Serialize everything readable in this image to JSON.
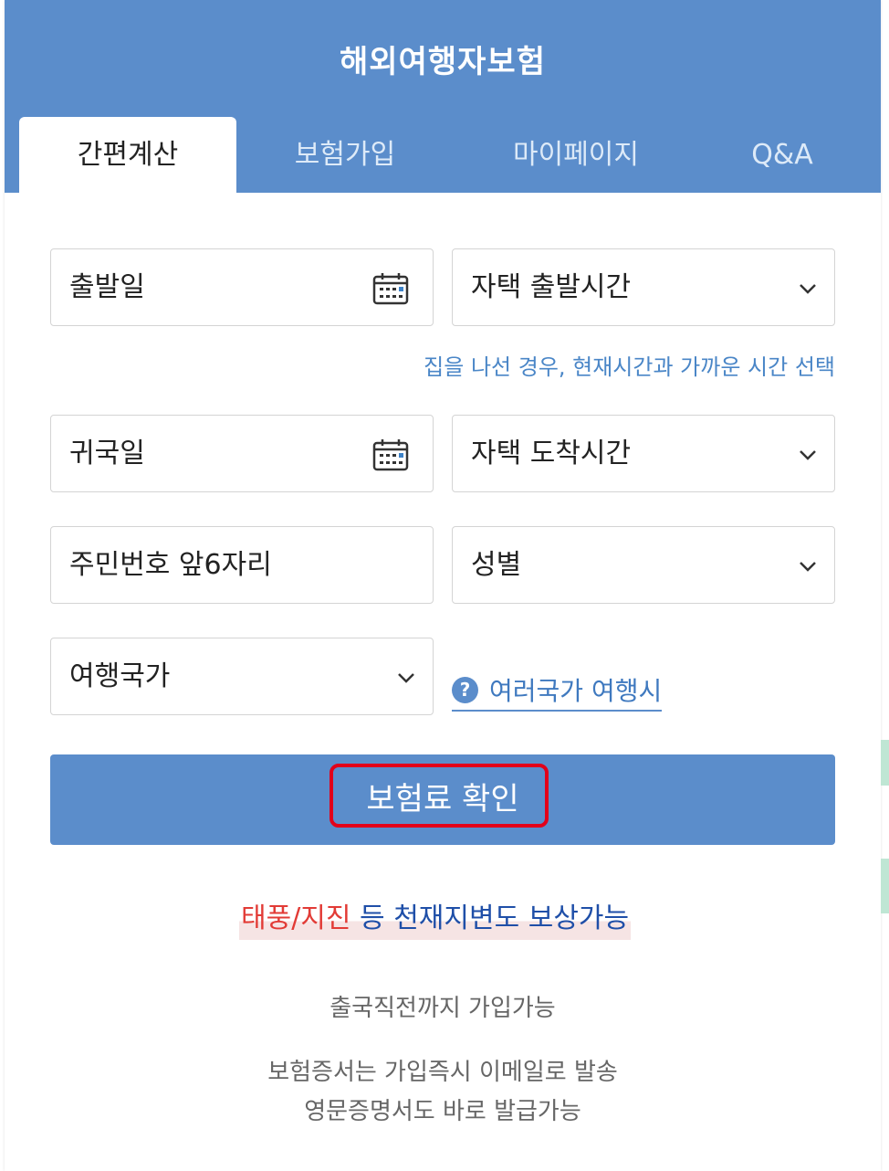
{
  "header": {
    "title": "해외여행자보험",
    "tabs": [
      {
        "label": "간편계산",
        "active": true
      },
      {
        "label": "보험가입",
        "active": false
      },
      {
        "label": "마이페이지",
        "active": false
      },
      {
        "label": "Q&A",
        "active": false
      }
    ]
  },
  "form": {
    "departure_date": {
      "label": "출발일",
      "icon": "calendar-icon"
    },
    "departure_time": {
      "label": "자택 출발시간",
      "icon": "chevron-down-icon"
    },
    "departure_hint": "집을 나선 경우, 현재시간과 가까운 시간 선택",
    "return_date": {
      "label": "귀국일",
      "icon": "calendar-icon"
    },
    "arrival_time": {
      "label": "자택 도착시간",
      "icon": "chevron-down-icon"
    },
    "id_number": {
      "label": "주민번호 앞6자리"
    },
    "gender": {
      "label": "성별",
      "icon": "chevron-down-icon"
    },
    "country": {
      "label": "여행국가",
      "icon": "chevron-down-icon"
    },
    "multi_country_link": {
      "icon_text": "?",
      "label": "여러국가 여행시"
    },
    "submit_label": "보험료 확인"
  },
  "promo": {
    "red_text": "태풍/지진",
    "blue_text": " 등 천재지변도 보상가능"
  },
  "info": {
    "line1": "출국직전까지 가입가능",
    "line2": "보험증서는 가입즉시 이메일로 발송",
    "line3": "영문증명서도 바로 발급가능"
  },
  "colors": {
    "brand": "#5b8dcb",
    "highlight": "#e2001a",
    "promo_red": "#e23b36",
    "promo_blue": "#1f4fa8"
  }
}
